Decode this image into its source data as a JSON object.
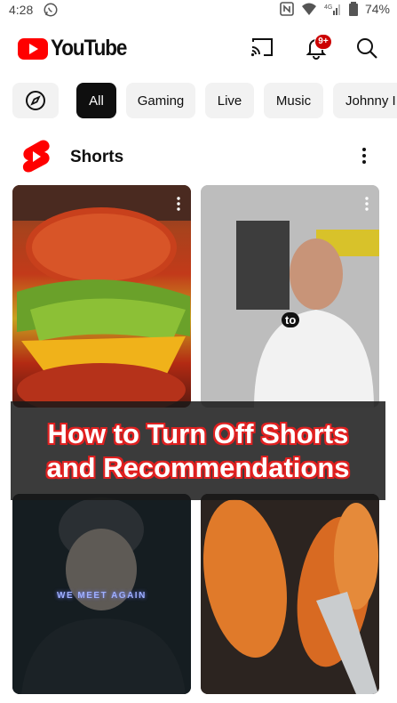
{
  "status_bar": {
    "time": "4:28",
    "battery": "74%"
  },
  "app": {
    "name": "YouTube",
    "notification_badge": "9+",
    "brand_color": "#ff0000"
  },
  "chips": [
    {
      "label": "All",
      "selected": true
    },
    {
      "label": "Gaming",
      "selected": false
    },
    {
      "label": "Live",
      "selected": false
    },
    {
      "label": "Music",
      "selected": false
    },
    {
      "label": "Johnny I",
      "selected": false
    }
  ],
  "shorts": {
    "title": "Shorts",
    "tiles": [
      {
        "caption": ""
      },
      {
        "caption": "to"
      },
      {
        "caption": "WE MEET AGAIN"
      },
      {
        "caption": ""
      }
    ]
  },
  "overlay": {
    "line1": "How to Turn Off Shorts",
    "line2": "and Recommendations"
  },
  "icons": [
    "whatsapp-icon",
    "nfc-icon",
    "wifi-icon",
    "signal-icon",
    "battery-icon",
    "cast-icon",
    "bell-icon",
    "search-icon",
    "explore-icon",
    "shorts-icon",
    "more-vert-icon"
  ]
}
